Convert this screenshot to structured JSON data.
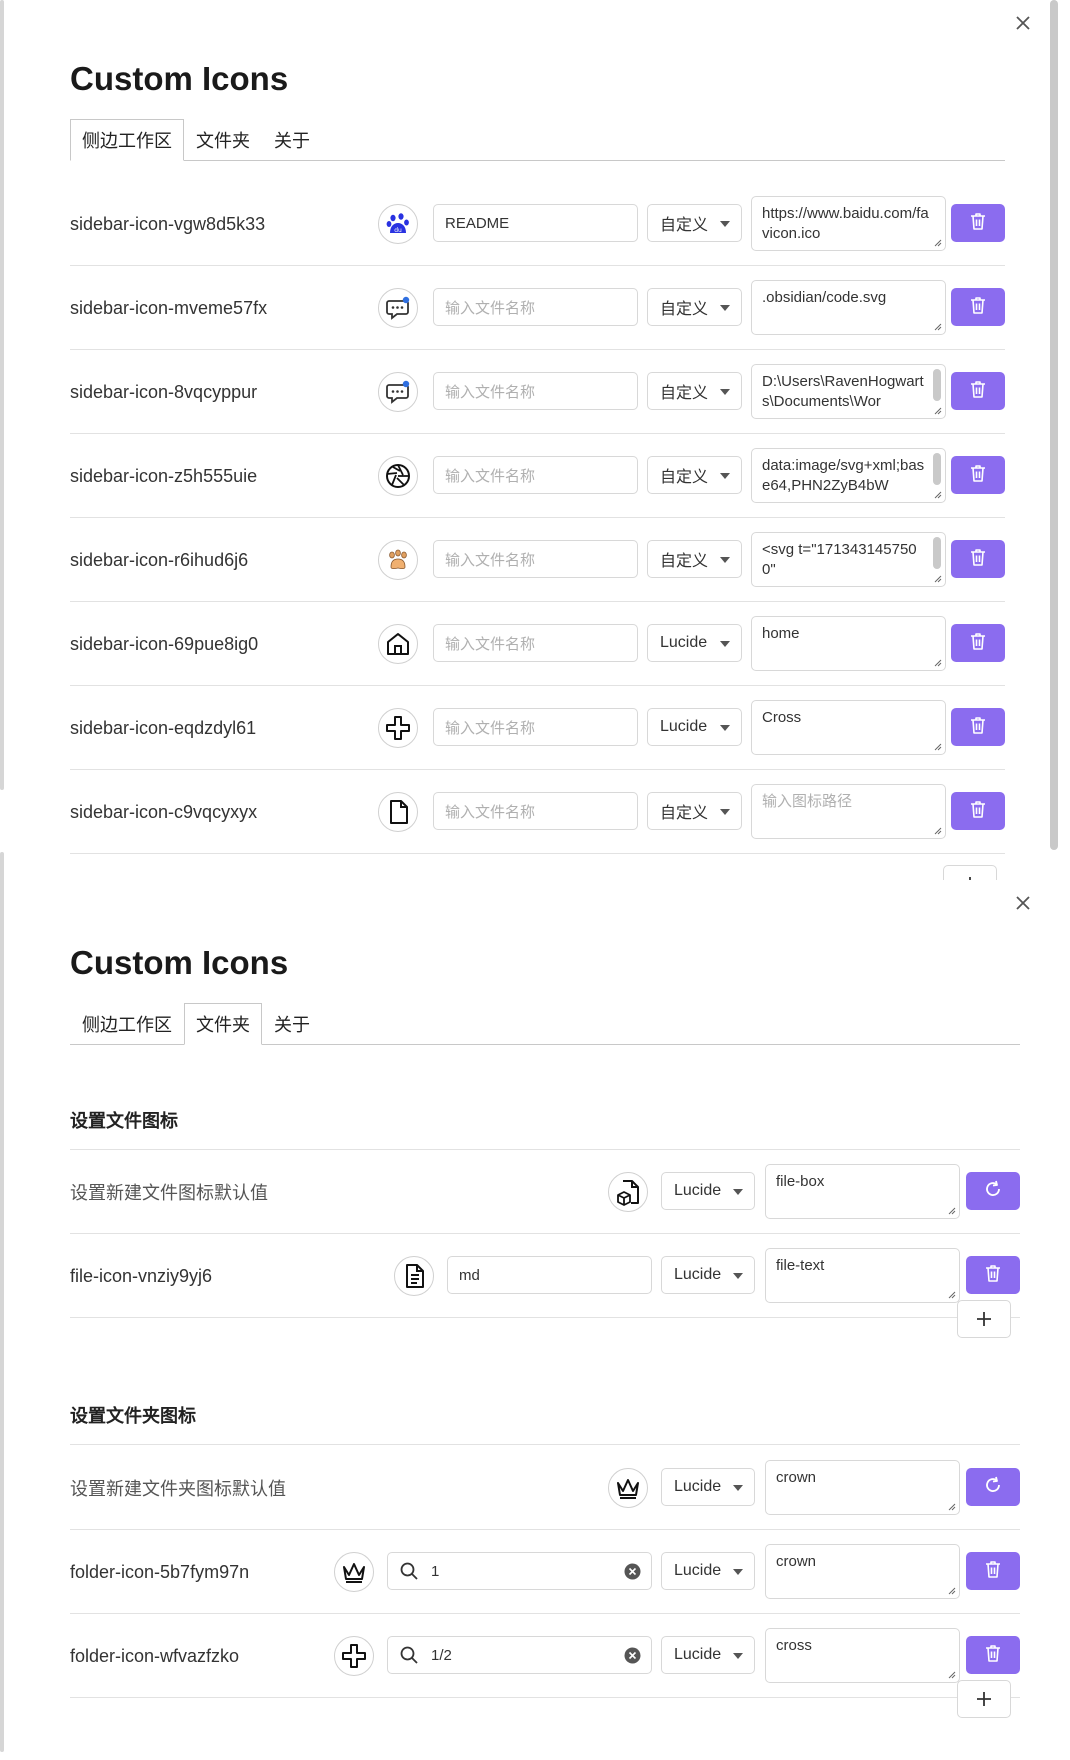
{
  "app": {
    "title": "Custom Icons"
  },
  "tabs": [
    {
      "label": "侧边工作区"
    },
    {
      "label": "文件夹"
    },
    {
      "label": "关于"
    }
  ],
  "sidebar_rows": [
    {
      "id": "sidebar-icon-vgw8d5k33",
      "icon": "baidu-paw-icon",
      "name_value": "README",
      "name_placeholder": "",
      "type": "自定义",
      "path": "https://www.baidu.com/favicon.ico"
    },
    {
      "id": "sidebar-icon-mveme57fx",
      "icon": "chat-bubble-icon",
      "name_value": "",
      "name_placeholder": "输入文件名称",
      "type": "自定义",
      "path": ".obsidian/code.svg"
    },
    {
      "id": "sidebar-icon-8vqcyppur",
      "icon": "chat-bubble-icon",
      "name_value": "",
      "name_placeholder": "输入文件名称",
      "type": "自定义",
      "path": "D:\\Users\\RavenHogwarts\\Documents\\Wor"
    },
    {
      "id": "sidebar-icon-z5h555uie",
      "icon": "aperture-icon",
      "name_value": "",
      "name_placeholder": "输入文件名称",
      "type": "自定义",
      "path": "data:image/svg+xml;base64,PHN2ZyB4bW"
    },
    {
      "id": "sidebar-icon-r6ihud6j6",
      "icon": "paw-icon",
      "name_value": "",
      "name_placeholder": "输入文件名称",
      "type": "自定义",
      "path": "<svg t=\"1713431457500\""
    },
    {
      "id": "sidebar-icon-69pue8ig0",
      "icon": "home-icon",
      "name_value": "",
      "name_placeholder": "输入文件名称",
      "type": "Lucide",
      "path": "home"
    },
    {
      "id": "sidebar-icon-eqdzdyl61",
      "icon": "cross-icon",
      "name_value": "",
      "name_placeholder": "输入文件名称",
      "type": "Lucide",
      "path": "Cross"
    },
    {
      "id": "sidebar-icon-c9vqcyxyx",
      "icon": "file-icon",
      "name_value": "",
      "name_placeholder": "输入文件名称",
      "type": "自定义",
      "path": "",
      "path_placeholder": "输入图标路径"
    }
  ],
  "file_section": {
    "heading": "设置文件图标",
    "default_label": "设置新建文件图标默认值",
    "default_icon": "file-box-icon",
    "default_type": "Lucide",
    "default_path": "file-box",
    "rows": [
      {
        "id": "file-icon-vnziy9yj6",
        "icon": "file-text-icon",
        "name_value": "md",
        "type": "Lucide",
        "path": "file-text"
      }
    ]
  },
  "folder_section": {
    "heading": "设置文件夹图标",
    "default_label": "设置新建文件夹图标默认值",
    "default_icon": "crown-icon",
    "default_type": "Lucide",
    "default_path": "crown",
    "rows": [
      {
        "id": "folder-icon-5b7fym97n",
        "icon": "crown-icon",
        "search_value": "1",
        "type": "Lucide",
        "path": "crown"
      },
      {
        "id": "folder-icon-wfvazfzko",
        "icon": "cross-icon",
        "search_value": "1/2",
        "type": "Lucide",
        "path": "cross"
      }
    ]
  },
  "colors": {
    "accent": "#8b6cef",
    "border": "#d8d8d8",
    "baidu_blue": "#2932e1"
  }
}
